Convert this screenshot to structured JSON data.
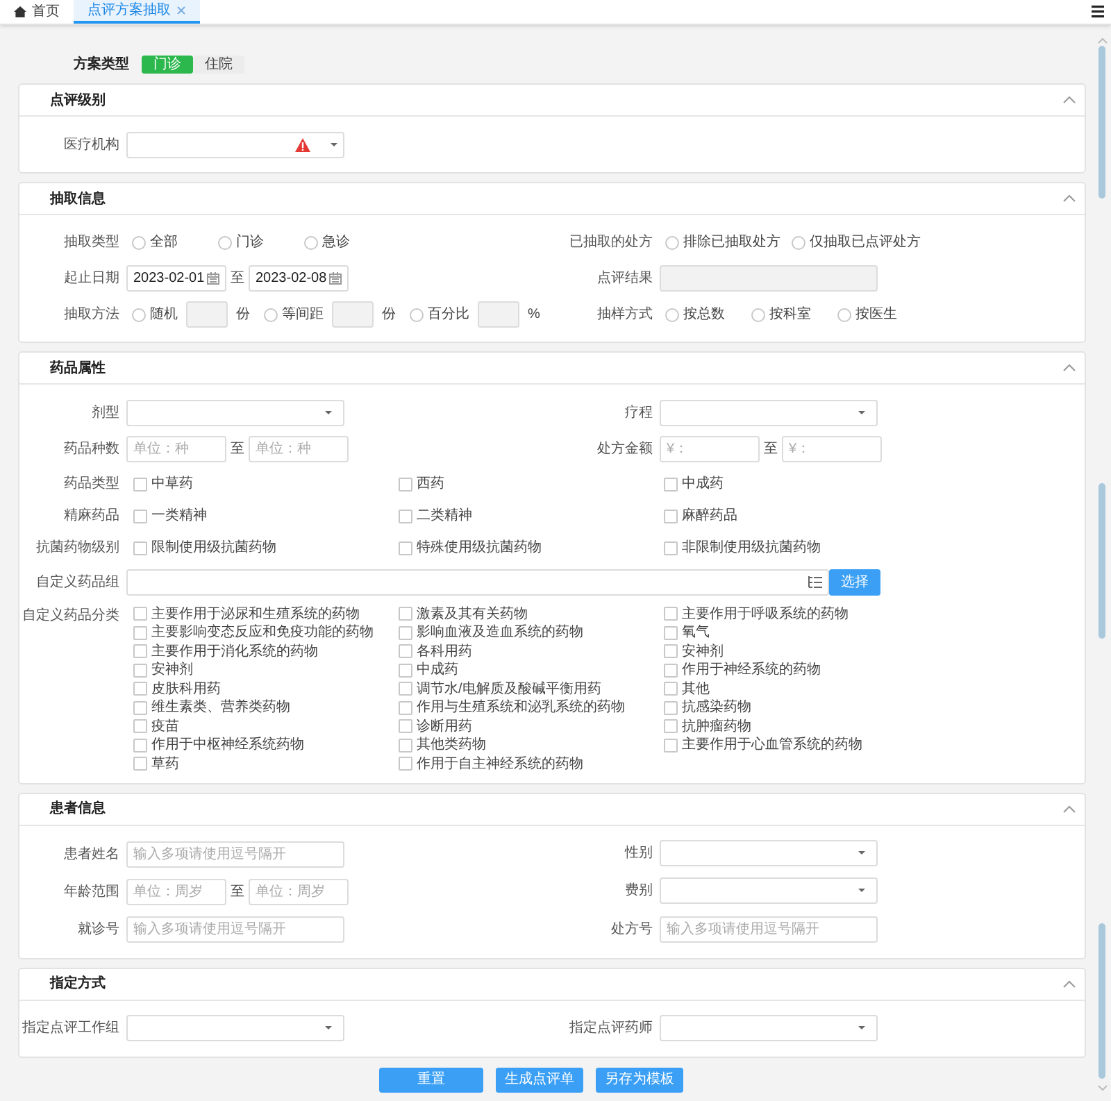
{
  "tabs": [
    {
      "label": "首页",
      "kind": "home",
      "selected": false,
      "closable": false
    },
    {
      "label": "点评方案抽取",
      "kind": "page",
      "selected": true,
      "closable": true
    }
  ],
  "scheme_type": {
    "label": "方案类型",
    "options": [
      {
        "label": "门诊",
        "selected": true
      },
      {
        "label": "住院",
        "selected": false
      }
    ]
  },
  "panels": [
    {
      "title": "点评级别",
      "rows": [
        [
          {
            "kind": "select",
            "label": "医疗机构",
            "invalid": true
          }
        ]
      ]
    },
    {
      "title": "抽取信息",
      "rows": [
        [
          {
            "kind": "radio",
            "label": "抽取类型",
            "options": [
              {
                "label": "全部",
                "selected": false
              },
              {
                "label": "门诊",
                "selected": false
              },
              {
                "label": "急诊",
                "selected": false
              }
            ]
          },
          {
            "kind": "radio",
            "label": "已抽取的处方",
            "options": [
              {
                "label": "排除已抽取处方",
                "selected": false
              },
              {
                "label": "仅抽取已点评处方",
                "selected": false
              }
            ]
          }
        ],
        [
          {
            "kind": "date_range",
            "label": "起止日期",
            "from": "2023-02-01",
            "to": "2023-02-08",
            "separator": "至"
          },
          {
            "kind": "text",
            "label": "点评结果",
            "disabled": true
          }
        ],
        [
          {
            "kind": "radio",
            "label": "抽取方法",
            "options": [
              {
                "label": "随机",
                "selected": false,
                "unit": "份"
              },
              {
                "label": "等间距",
                "selected": false,
                "unit": "份"
              },
              {
                "label": "百分比",
                "selected": false,
                "unit": "%"
              }
            ]
          },
          {
            "kind": "radio",
            "label": "抽样方式",
            "options": [
              {
                "label": "按总数",
                "selected": false
              },
              {
                "label": "按科室",
                "selected": false
              },
              {
                "label": "按医生",
                "selected": false
              }
            ]
          }
        ]
      ]
    },
    {
      "title": "药品属性",
      "rows": [
        [
          {
            "kind": "select",
            "label": "剂型"
          },
          {
            "kind": "select",
            "label": "疗程"
          }
        ],
        [
          {
            "kind": "range",
            "label": "药品种数",
            "from_placeholder": "单位：种",
            "to_placeholder": "单位：种",
            "separator": "至"
          },
          {
            "kind": "range",
            "label": "处方金额",
            "from_placeholder": "¥：",
            "to_placeholder": "¥：",
            "separator": "至"
          }
        ],
        [
          {
            "kind": "checkbox",
            "label": "药品类型",
            "options": [
              {
                "label": "中草药",
                "checked": false
              },
              {
                "label": "西药",
                "checked": false
              },
              {
                "label": "中成药",
                "checked": false
              }
            ]
          }
        ],
        [
          {
            "kind": "checkbox",
            "label": "精麻药品",
            "options": [
              {
                "label": "一类精神",
                "checked": false
              },
              {
                "label": "二类精神",
                "checked": false
              },
              {
                "label": "麻醉药品",
                "checked": false
              }
            ]
          }
        ],
        [
          {
            "kind": "checkbox",
            "label": "抗菌药物级别",
            "options": [
              {
                "label": "限制使用级抗菌药物",
                "checked": false
              },
              {
                "label": "特殊使用级抗菌药物",
                "checked": false
              },
              {
                "label": "非限制使用级抗菌药物",
                "checked": false
              }
            ]
          }
        ],
        [
          {
            "kind": "picker",
            "label": "自定义药品组",
            "button": "选择"
          }
        ],
        [
          {
            "kind": "checkgrid",
            "label": "自定义药品分类",
            "options": [
              {
                "label": "主要作用于泌尿和生殖系统的药物",
                "checked": false
              },
              {
                "label": "激素及其有关药物",
                "checked": false
              },
              {
                "label": "主要作用于呼吸系统的药物",
                "checked": false
              },
              {
                "label": "主要影响变态反应和免疫功能的药物",
                "checked": false
              },
              {
                "label": "影响血液及造血系统的药物",
                "checked": false
              },
              {
                "label": "氧气",
                "checked": false
              },
              {
                "label": "主要作用于消化系统的药物",
                "checked": false
              },
              {
                "label": "各科用药",
                "checked": false
              },
              {
                "label": "安神剂",
                "checked": false
              },
              {
                "label": "安神剂",
                "checked": false
              },
              {
                "label": "中成药",
                "checked": false
              },
              {
                "label": "作用于神经系统的药物",
                "checked": false
              },
              {
                "label": "皮肤科用药",
                "checked": false
              },
              {
                "label": "调节水/电解质及酸碱平衡用药",
                "checked": false
              },
              {
                "label": "其他",
                "checked": false
              },
              {
                "label": "维生素类、营养类药物",
                "checked": false
              },
              {
                "label": "作用与生殖系统和泌乳系统的药物",
                "checked": false
              },
              {
                "label": "抗感染药物",
                "checked": false
              },
              {
                "label": "疫苗",
                "checked": false
              },
              {
                "label": "诊断用药",
                "checked": false
              },
              {
                "label": "抗肿瘤药物",
                "checked": false
              },
              {
                "label": "作用于中枢神经系统药物",
                "checked": false
              },
              {
                "label": "其他类药物",
                "checked": false
              },
              {
                "label": "主要作用于心血管系统的药物",
                "checked": false
              },
              {
                "label": "草药",
                "checked": false
              },
              {
                "label": "作用于自主神经系统的药物",
                "checked": false
              }
            ]
          }
        ]
      ]
    },
    {
      "title": "患者信息",
      "rows": [
        [
          {
            "kind": "text",
            "label": "患者姓名",
            "placeholder": "输入多项请使用逗号隔开"
          },
          {
            "kind": "select",
            "label": "性别"
          }
        ],
        [
          {
            "kind": "range",
            "label": "年龄范围",
            "from_placeholder": "单位：周岁",
            "to_placeholder": "单位：周岁",
            "separator": "至"
          },
          {
            "kind": "select",
            "label": "费别"
          }
        ],
        [
          {
            "kind": "text",
            "label": "就诊号",
            "placeholder": "输入多项请使用逗号隔开"
          },
          {
            "kind": "text",
            "label": "处方号",
            "placeholder": "输入多项请使用逗号隔开"
          }
        ]
      ]
    },
    {
      "title": "指定方式",
      "rows": [
        [
          {
            "kind": "select",
            "label": "指定点评工作组"
          },
          {
            "kind": "select",
            "label": "指定点评药师"
          }
        ]
      ]
    }
  ],
  "buttons": [
    "重置",
    "生成点评单",
    "另存为模板"
  ]
}
